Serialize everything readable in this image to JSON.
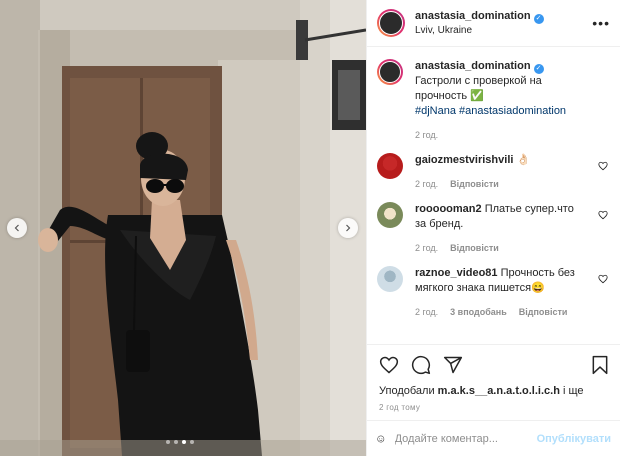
{
  "post": {
    "username": "anastasia_domination",
    "location": "Lviv, Ukraine",
    "caption_text": "Гастроли с проверкой на прочность ✅",
    "hashtags": "#djNana #anastasiadomination",
    "caption_time": "2 год.",
    "media": {
      "slide_count": 4,
      "active_slide": 3
    }
  },
  "comments": [
    {
      "username": "gaiozmestvirishvili",
      "text": "👌🏻",
      "time": "2 год.",
      "likes": "",
      "reply": "Відповісти"
    },
    {
      "username": "roooooman2",
      "text": "Платье супер.что за бренд.",
      "time": "2 год.",
      "likes": "",
      "reply": "Відповісти"
    },
    {
      "username": "raznoe_video81",
      "text": "Прочность без мягкого знака пишется😄",
      "time": "2 год.",
      "likes": "3 вподобань",
      "reply": "Відповісти"
    }
  ],
  "actions": {
    "liked_by_prefix": "Уподобали ",
    "liked_by_user": "m.a.k.s__a.n.a.t.o.l.i.c.h",
    "liked_by_suffix": " і ще",
    "time_ago": "2 год тому"
  },
  "comment_box": {
    "placeholder": "Додайте коментар...",
    "publish_label": "Опублікувати"
  },
  "colors": {
    "link": "#00376b",
    "verified": "#3897f0",
    "publish_disabled": "#b2dffc",
    "muted": "#8e8e8e"
  },
  "icons": [
    "chevron-left-icon",
    "chevron-right-icon",
    "verified-icon",
    "more-icon",
    "heart-icon",
    "comment-icon",
    "share-icon",
    "bookmark-icon",
    "emoji-icon"
  ]
}
